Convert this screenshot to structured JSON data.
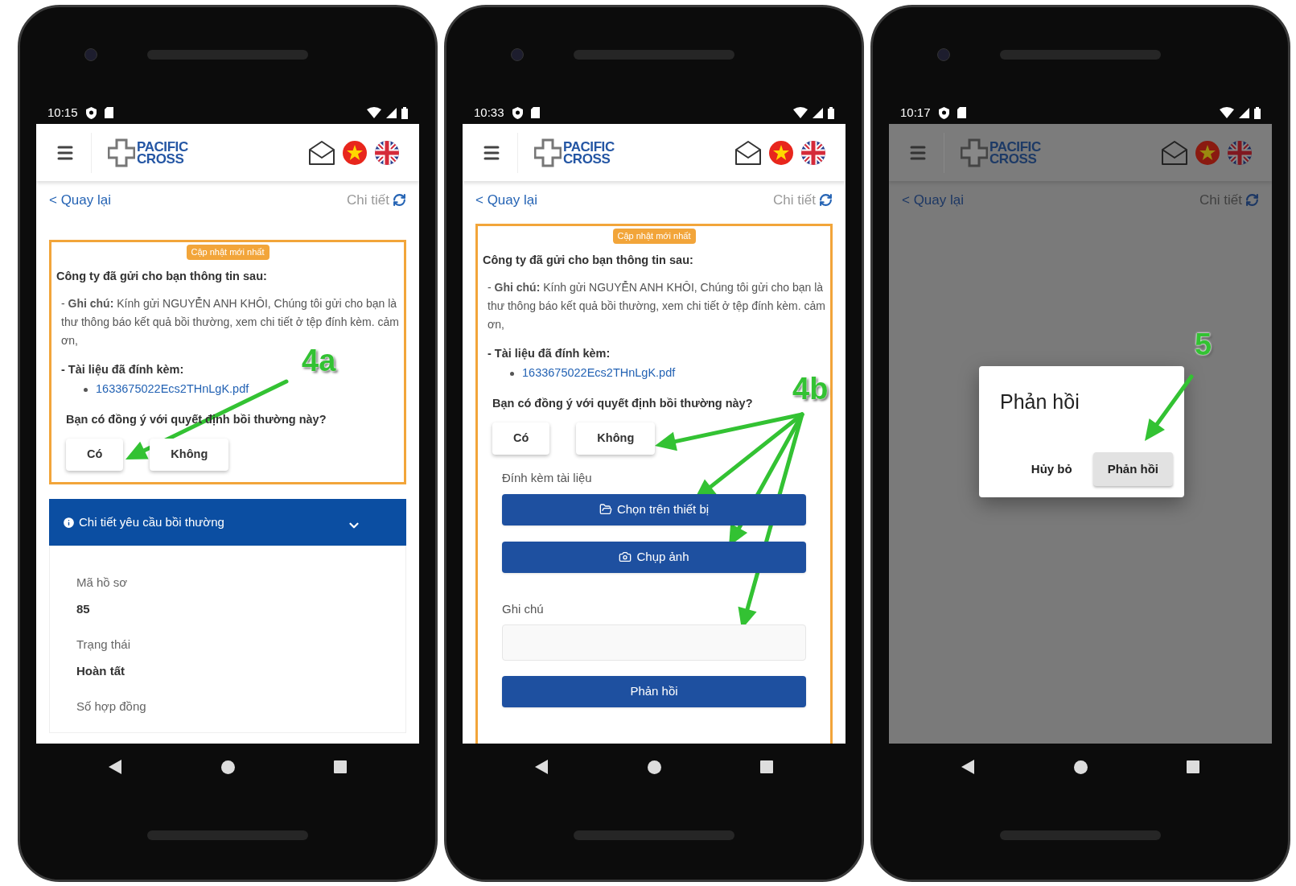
{
  "phones": [
    {
      "time": "10:15",
      "logo": [
        "PACIFIC",
        "CROSS"
      ],
      "back": "< Quay lại",
      "title": "Chi tiết",
      "step": "4a",
      "message": {
        "badge": "Cập nhật mới nhất",
        "heading": "Công ty đã gửi cho bạn thông tin sau:",
        "note": "- **Ghi chú:** Kính gửi NGUYỄN ANH KHÔI, Chúng tôi gửi cho bạn là thư thông báo kết quả bồi thường, xem chi tiết ở tệp đính kèm. cảm ơn,",
        "attachments_label": "- Tài liệu đã đính kèm:",
        "attachments": [
          "1633675022Ecs2THnLgK.pdf"
        ],
        "question": "Bạn có đồng ý với quyết định bồi thường này?",
        "choices": [
          "Có",
          "Không"
        ]
      },
      "details": {
        "title": "Chi tiết yêu cầu bồi thường",
        "fields": [
          {
            "label": "Mã hồ sơ",
            "value": "85"
          },
          {
            "label": "Trạng thái",
            "value": "Hoàn tất"
          },
          {
            "label": "Số hợp đồng"
          }
        ]
      }
    },
    {
      "time": "10:33",
      "logo": [
        "PACIFIC",
        "CROSS"
      ],
      "back": "< Quay lại",
      "title": "Chi tiết",
      "step": "4b",
      "message": {
        "badge": "Cập nhật mới nhất",
        "heading": "Công ty đã gửi cho bạn thông tin sau:",
        "note": "- **Ghi chú:** Kính gửi NGUYỄN ANH KHÔI, Chúng tôi gửi cho bạn là thư thông báo kết quả bồi thường, xem chi tiết ở tệp đính kèm. cảm ơn,",
        "attachments_label": "- Tài liệu đã đính kèm:",
        "attachments": [
          "1633675022Ecs2THnLgK.pdf"
        ],
        "question": "Bạn có đồng ý với quyết định bồi thường này?",
        "choices": [
          "Có",
          "Không"
        ]
      },
      "reply": {
        "attach_label": "Đính kèm tài liệu",
        "actions": [
          {
            "kind": "folder",
            "label": "Chọn trên thiết bị"
          },
          {
            "kind": "camera",
            "label": "Chụp ảnh"
          }
        ],
        "note_label": "Ghi chú",
        "submit": "Phản hồi"
      }
    },
    {
      "time": "10:17",
      "logo": [
        "PACIFIC",
        "CROSS"
      ],
      "back": "< Quay lại",
      "title": "Chi tiết",
      "step": "5",
      "dialog": {
        "title": "Phản hồi",
        "actions": [
          {
            "label": "Hủy bỏ",
            "selected": false
          },
          {
            "label": "Phản hồi",
            "selected": true
          }
        ]
      }
    }
  ]
}
